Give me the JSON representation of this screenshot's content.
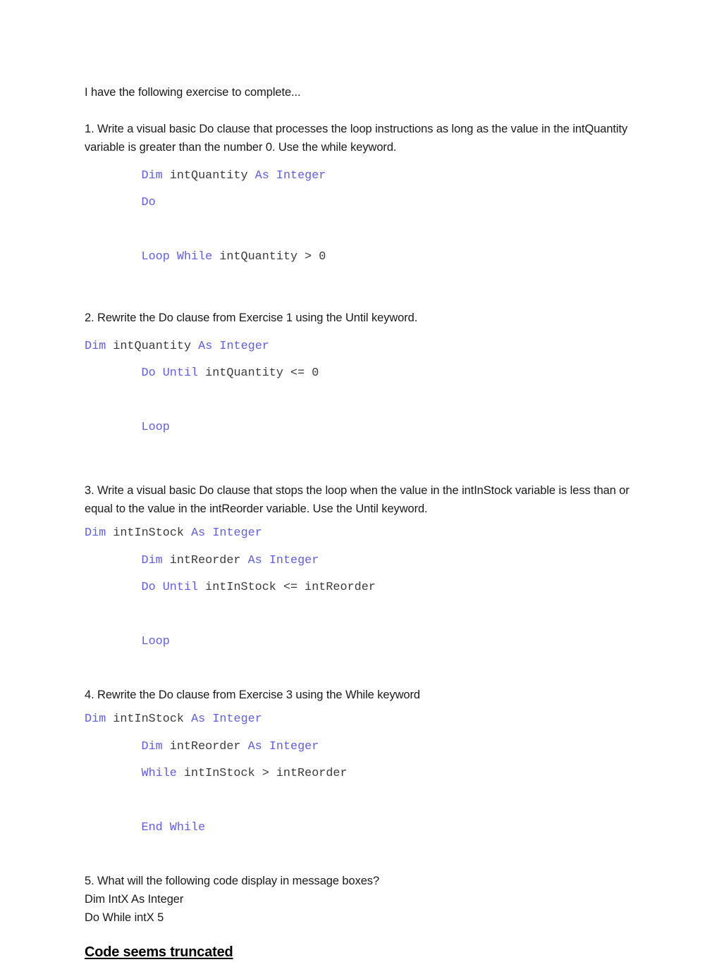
{
  "document": {
    "intro": "I have the following exercise to complete...",
    "exercises": [
      {
        "prompt": "1. Write a visual basic Do clause that processes the loop instructions as long as the value in the intQuantity variable is greater than the number 0. Use the while keyword.",
        "code": [
          {
            "indent": true,
            "tokens": [
              {
                "t": "Dim",
                "kw": true
              },
              {
                "t": " intQuantity ",
                "kw": false
              },
              {
                "t": "As",
                "kw": true
              },
              {
                "t": " ",
                "kw": false
              },
              {
                "t": "Integer",
                "kw": true
              }
            ]
          },
          {
            "indent": true,
            "tokens": [
              {
                "t": "Do",
                "kw": true
              }
            ]
          },
          {
            "indent": true,
            "tokens": [
              {
                "t": "",
                "kw": false
              }
            ]
          },
          {
            "indent": true,
            "tokens": [
              {
                "t": "Loop",
                "kw": true
              },
              {
                "t": " ",
                "kw": false
              },
              {
                "t": "While",
                "kw": true
              },
              {
                "t": " intQuantity > 0",
                "kw": false
              }
            ]
          }
        ]
      },
      {
        "prompt": "2. Rewrite the Do clause from Exercise 1 using the Until keyword.",
        "code": [
          {
            "indent": false,
            "tokens": [
              {
                "t": "Dim",
                "kw": true
              },
              {
                "t": " intQuantity ",
                "kw": false
              },
              {
                "t": "As",
                "kw": true
              },
              {
                "t": " ",
                "kw": false
              },
              {
                "t": "Integer",
                "kw": true
              }
            ]
          },
          {
            "indent": true,
            "tokens": [
              {
                "t": "Do",
                "kw": true
              },
              {
                "t": " ",
                "kw": false
              },
              {
                "t": "Until",
                "kw": true
              },
              {
                "t": " intQuantity <= 0",
                "kw": false
              }
            ]
          },
          {
            "indent": true,
            "tokens": [
              {
                "t": "",
                "kw": false
              }
            ]
          },
          {
            "indent": true,
            "tokens": [
              {
                "t": "Loop",
                "kw": true
              }
            ]
          }
        ]
      },
      {
        "prompt": "3. Write a visual basic Do clause that stops the loop when the value in the intInStock variable is less than or equal to the value in the intReorder variable. Use the Until keyword.",
        "code": [
          {
            "indent": false,
            "tokens": [
              {
                "t": "Dim",
                "kw": true
              },
              {
                "t": " intInStock ",
                "kw": false
              },
              {
                "t": "As",
                "kw": true
              },
              {
                "t": " ",
                "kw": false
              },
              {
                "t": "Integer",
                "kw": true
              }
            ]
          },
          {
            "indent": true,
            "tokens": [
              {
                "t": "Dim",
                "kw": true
              },
              {
                "t": " intReorder ",
                "kw": false
              },
              {
                "t": "As",
                "kw": true
              },
              {
                "t": " ",
                "kw": false
              },
              {
                "t": "Integer",
                "kw": true
              }
            ]
          },
          {
            "indent": true,
            "tokens": [
              {
                "t": "Do",
                "kw": true
              },
              {
                "t": " ",
                "kw": false
              },
              {
                "t": "Until",
                "kw": true
              },
              {
                "t": " intInStock <= intReorder",
                "kw": false
              }
            ]
          },
          {
            "indent": true,
            "tokens": [
              {
                "t": "",
                "kw": false
              }
            ]
          },
          {
            "indent": true,
            "tokens": [
              {
                "t": "Loop",
                "kw": true
              }
            ]
          }
        ]
      },
      {
        "prompt": "4. Rewrite the Do clause from Exercise 3 using the While keyword",
        "code": [
          {
            "indent": false,
            "tokens": [
              {
                "t": "Dim",
                "kw": true
              },
              {
                "t": " intInStock ",
                "kw": false
              },
              {
                "t": "As",
                "kw": true
              },
              {
                "t": " ",
                "kw": false
              },
              {
                "t": "Integer",
                "kw": true
              }
            ]
          },
          {
            "indent": true,
            "tokens": [
              {
                "t": "Dim",
                "kw": true
              },
              {
                "t": " intReorder ",
                "kw": false
              },
              {
                "t": "As",
                "kw": true
              },
              {
                "t": " ",
                "kw": false
              },
              {
                "t": "Integer",
                "kw": true
              }
            ]
          },
          {
            "indent": true,
            "tokens": [
              {
                "t": "While",
                "kw": true
              },
              {
                "t": " intInStock > intReorder",
                "kw": false
              }
            ]
          },
          {
            "indent": true,
            "tokens": [
              {
                "t": "",
                "kw": false
              }
            ]
          },
          {
            "indent": true,
            "tokens": [
              {
                "t": "End",
                "kw": true
              },
              {
                "t": " ",
                "kw": false
              },
              {
                "t": "While",
                "kw": true
              }
            ]
          }
        ]
      },
      {
        "prompt": "5. What will the following code display in message boxes?",
        "plain_lines": [
          "Dim IntX As Integer",
          "Do While intX 5"
        ]
      }
    ],
    "note": "Code seems truncated"
  },
  "colors": {
    "keyword": "#5f5fe6",
    "code_text": "#3b3b3b",
    "body_text": "#1a1a1a",
    "page_background": "#ffffff"
  }
}
